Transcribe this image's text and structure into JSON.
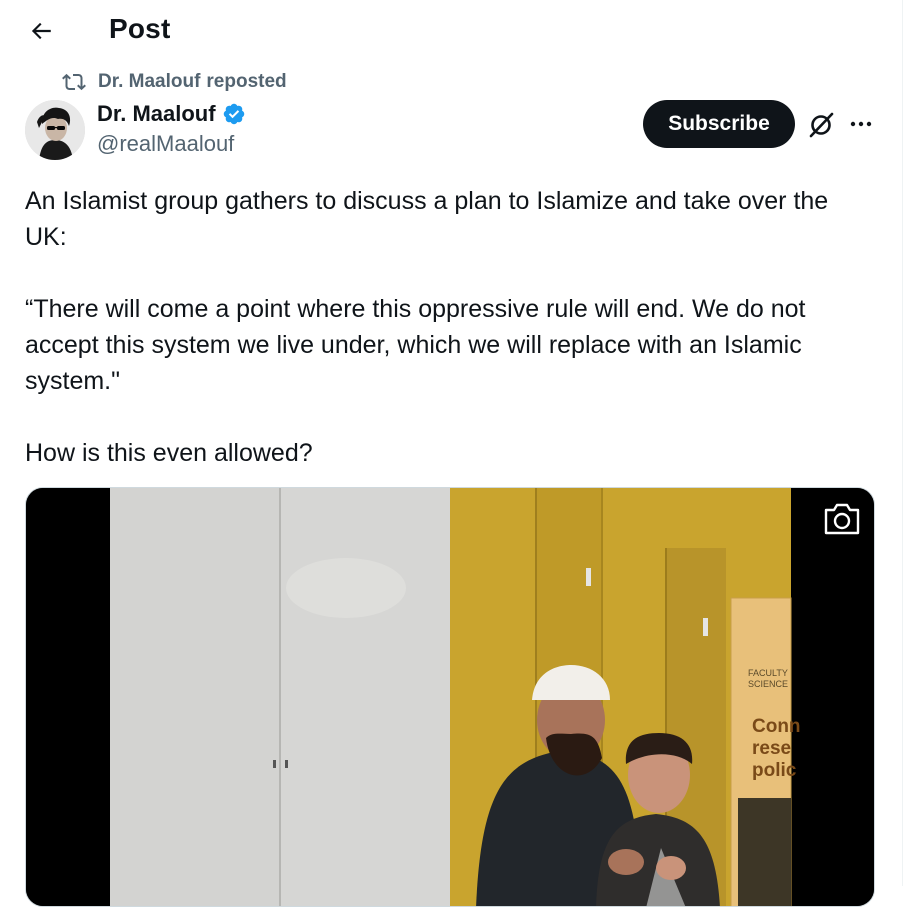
{
  "header": {
    "title": "Post",
    "back_icon": "arrow-left-icon"
  },
  "repost": {
    "icon": "repost-icon",
    "user": "Dr. Maalouf",
    "action": "reposted"
  },
  "author": {
    "name": "Dr. Maalouf",
    "handle": "@realMaalouf",
    "verified": true,
    "verified_color": "#1d9bf0"
  },
  "actions": {
    "subscribe_label": "Subscribe",
    "grok_icon": "grok-icon",
    "more_icon": "more-dots-icon"
  },
  "post": {
    "line1": "An Islamist group gathers to discuss a plan to Islamize and take over the UK:",
    "line2": "“There will come a point where this oppressive rule will end. We do not accept this system we live under, which we will replace with an Islamic system.\"",
    "line3": "How is this even allowed?"
  },
  "media": {
    "banner_text_small_1": "FACULTY",
    "banner_text_small_2": "SCIENCE",
    "banner_text_large_1": "Conn",
    "banner_text_large_2": "rese",
    "banner_text_large_3": "polic",
    "camera_icon": "camera-icon"
  },
  "colors": {
    "text": "#0f1419",
    "secondary": "#536471",
    "accent": "#1d9bf0",
    "wall_yellow": "#c9a42e"
  }
}
